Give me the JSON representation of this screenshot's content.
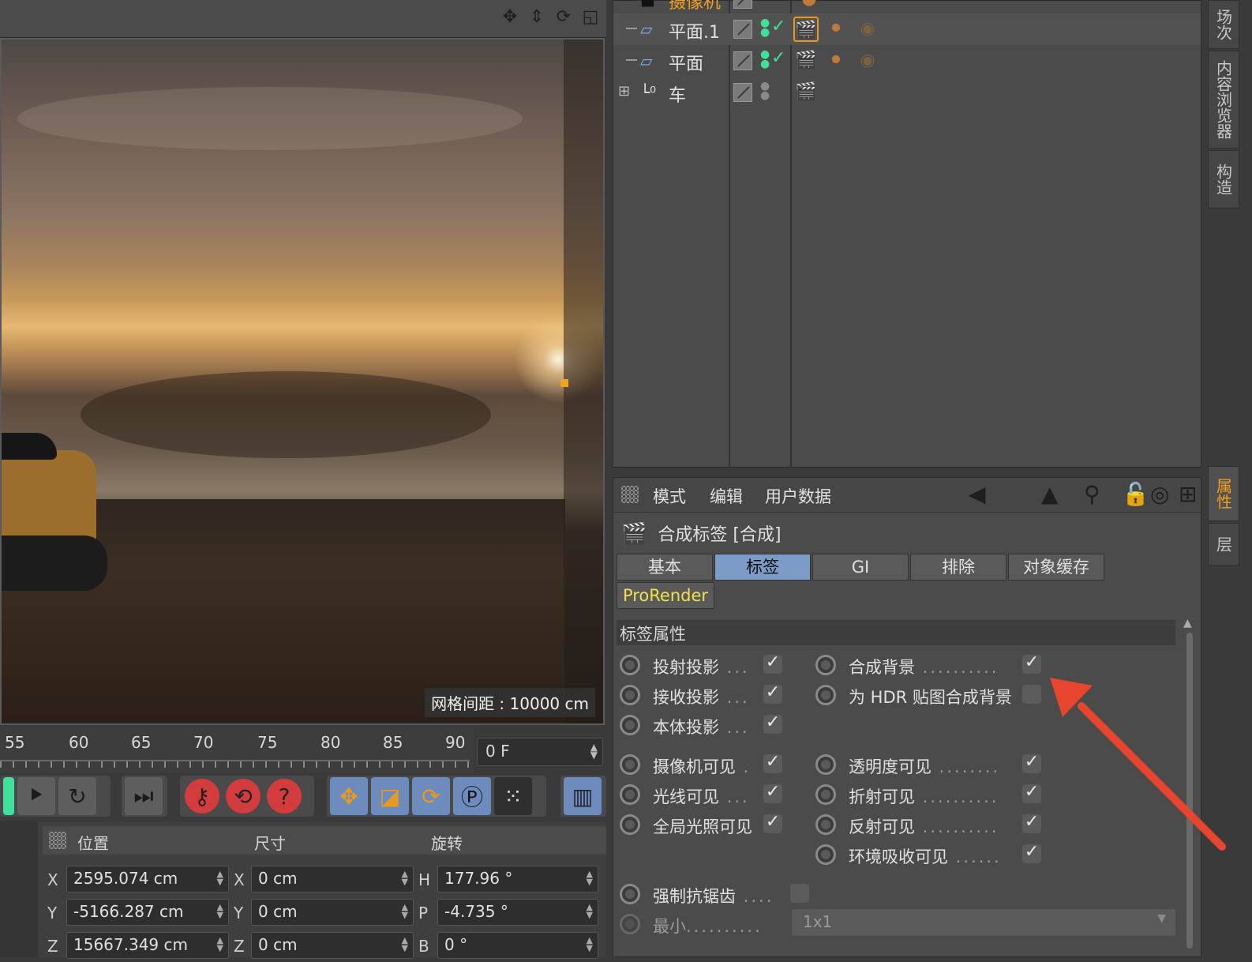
{
  "viewport": {
    "grid_label": "网格间距 : 10000 cm",
    "header_icons": [
      "move-view-icon",
      "dolly-view-icon",
      "rotate-view-icon",
      "toggle-view-icon"
    ]
  },
  "timeline": {
    "ticks": [
      "55",
      "60",
      "65",
      "70",
      "75",
      "80",
      "85",
      "90"
    ],
    "current_frame": "0 F"
  },
  "coordinates": {
    "headers": {
      "position": "位置",
      "size": "尺寸",
      "rotation": "旋转"
    },
    "rows": [
      {
        "axis": "X",
        "position": "2595.074 cm",
        "size_axis": "X",
        "size": "0 cm",
        "rot_axis": "H",
        "rotation": "177.96 °"
      },
      {
        "axis": "Y",
        "position": "-5166.287 cm",
        "size_axis": "Y",
        "size": "0 cm",
        "rot_axis": "P",
        "rotation": "-4.735 °"
      },
      {
        "axis": "Z",
        "position": "15667.349 cm",
        "size_axis": "Z",
        "size": "0 cm",
        "rot_axis": "B",
        "rotation": "0 °"
      }
    ]
  },
  "object_manager": {
    "objects": [
      {
        "name": "摄像机"
      },
      {
        "name": "平面.1"
      },
      {
        "name": "平面"
      },
      {
        "name": "车"
      }
    ]
  },
  "attributes": {
    "menu": {
      "mode": "模式",
      "edit": "编辑",
      "userdata": "用户数据"
    },
    "title": "合成标签 [合成]",
    "tabs": [
      "基本",
      "标签",
      "GI",
      "排除",
      "对象缓存"
    ],
    "tab_prorender": "ProRender",
    "section": "标签属性",
    "props": {
      "cast_shadow": "投射投影",
      "receive_shadow": "接收投影",
      "self_shadow": "本体投影",
      "compositing_bg": "合成背景",
      "hdr_bg": "为 HDR 贴图合成背景",
      "camera_visible": "摄像机可见",
      "rays_visible": "光线可见",
      "gi_visible": "全局光照可见",
      "transparency_visible": "透明度可见",
      "refraction_visible": "折射可见",
      "reflection_visible": "反射可见",
      "ao_visible": "环境吸收可见",
      "force_aa": "强制抗锯齿",
      "min": "最小"
    },
    "min_value": "1x1"
  },
  "side_tabs": [
    "场次",
    "内容浏览器",
    "构造",
    "属性",
    "层"
  ]
}
